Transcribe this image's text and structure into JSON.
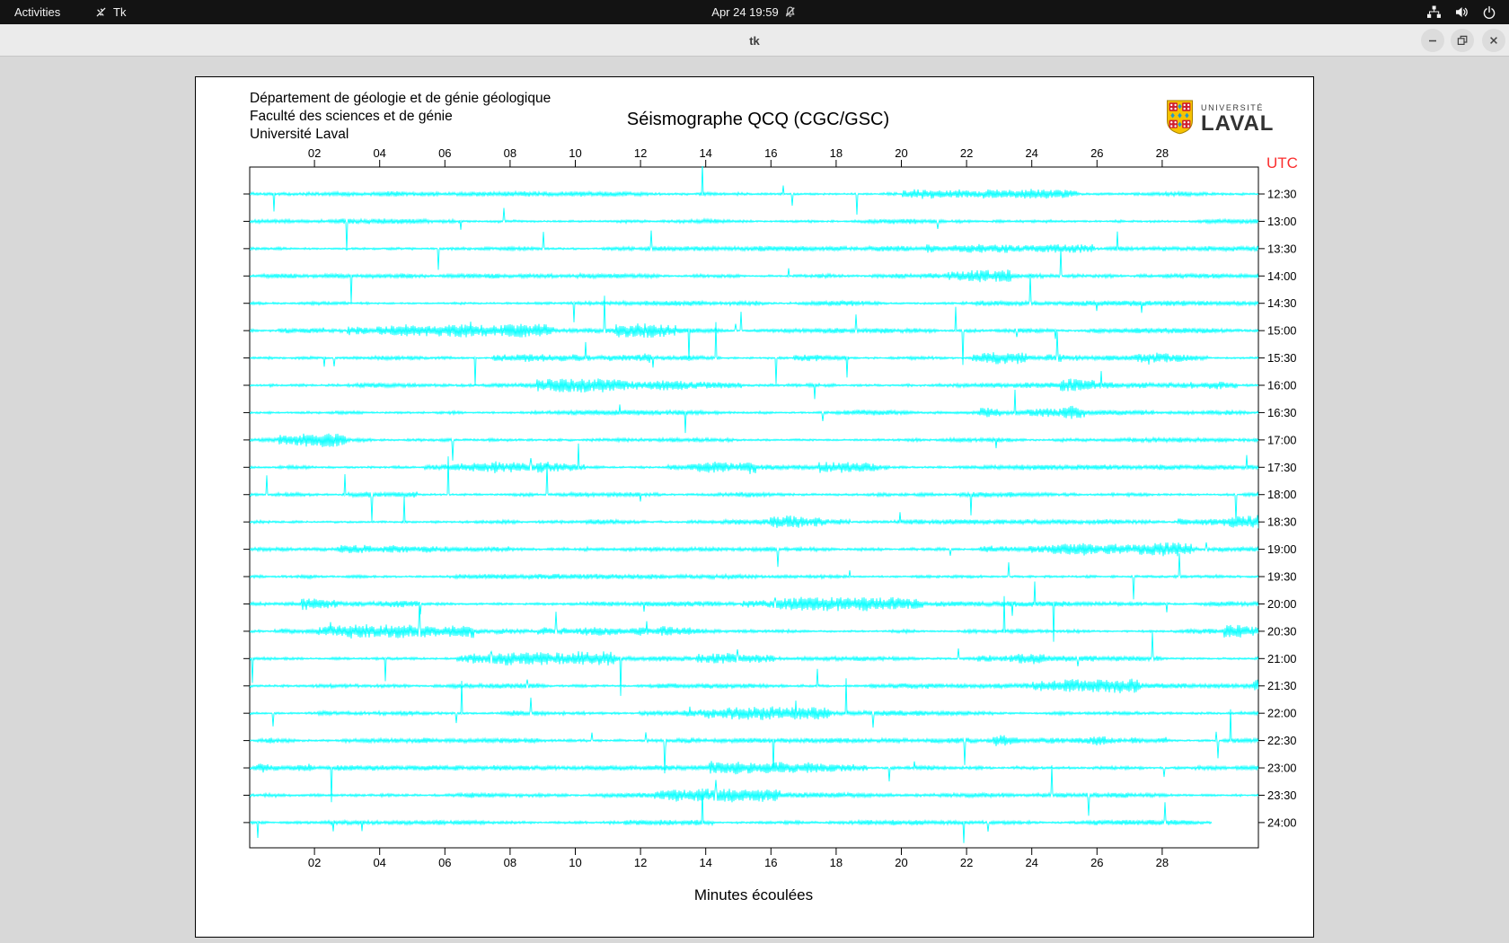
{
  "top_bar": {
    "activities_label": "Activities",
    "app_indicator_label": "Tk",
    "clock": "Apr 24 19:59"
  },
  "window": {
    "title": "tk"
  },
  "page": {
    "institution_lines": [
      "Département de géologie et de génie géologique",
      "Faculté des sciences et de génie",
      "Université Laval"
    ],
    "logo": {
      "top": "UNIVERSITÉ",
      "bottom": "LAVAL"
    }
  },
  "chart_data": {
    "type": "line",
    "title": "Séismographe QCQ (CGC/GSC)",
    "xlabel": "Minutes écoulées",
    "right_axis_title": "UTC",
    "x_tick_labels": [
      "02",
      "04",
      "06",
      "08",
      "10",
      "12",
      "14",
      "16",
      "18",
      "20",
      "22",
      "24",
      "26",
      "28"
    ],
    "x_tick_minutes": [
      2,
      4,
      6,
      8,
      10,
      12,
      14,
      16,
      18,
      20,
      22,
      24,
      26,
      28
    ],
    "x_range_minutes": [
      0,
      31
    ],
    "row_labels": [
      "12:30",
      "13:00",
      "13:30",
      "14:00",
      "14:30",
      "15:00",
      "15:30",
      "16:00",
      "16:30",
      "17:00",
      "17:30",
      "18:00",
      "18:30",
      "19:00",
      "19:30",
      "20:00",
      "20:30",
      "21:00",
      "21:30",
      "22:00",
      "22:30",
      "23:00",
      "23:30",
      "24:00"
    ],
    "trace_color": "#00ffff",
    "utc_color": "#fb2d2d",
    "axis_color": "#000000",
    "last_row_end_minute": 29.5,
    "grid": false,
    "noise_seed": 20250424
  }
}
